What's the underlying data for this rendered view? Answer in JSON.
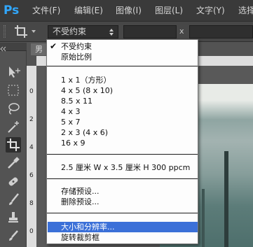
{
  "app": {
    "logo": "Ps"
  },
  "menubar": {
    "items": [
      {
        "label": "文件(F)"
      },
      {
        "label": "编辑(E)"
      },
      {
        "label": "图像(I)"
      },
      {
        "label": "图层(L)"
      },
      {
        "label": "文字(Y)"
      },
      {
        "label": "选择"
      }
    ]
  },
  "options": {
    "ratio_select": "不受约束",
    "x_label": "x"
  },
  "document": {
    "tab_label": "男",
    "ruler_numbers": [
      "0",
      "2",
      "4",
      "6",
      "8",
      "0",
      "2"
    ]
  },
  "dropdown": {
    "items": [
      {
        "label": "不受约束",
        "checked": true
      },
      {
        "label": "原始比例"
      },
      {
        "label": "1 x 1（方形）"
      },
      {
        "label": "4 x 5 (8 x 10)"
      },
      {
        "label": "8.5 x 11"
      },
      {
        "label": "4 x 3"
      },
      {
        "label": "5 x 7"
      },
      {
        "label": "2 x 3 (4 x 6)"
      },
      {
        "label": "16 x 9"
      },
      {
        "label": "2.5 厘米 W x 3.5 厘米 H 300 ppcm"
      },
      {
        "label": "存储预设..."
      },
      {
        "label": "删除预设..."
      },
      {
        "label": "大小和分辨率...",
        "highlighted": true
      },
      {
        "label": "旋转裁剪框"
      }
    ],
    "check_glyph": "✔"
  },
  "colors": {
    "highlight": "#3b70d8",
    "logo": "#31a8ff"
  }
}
